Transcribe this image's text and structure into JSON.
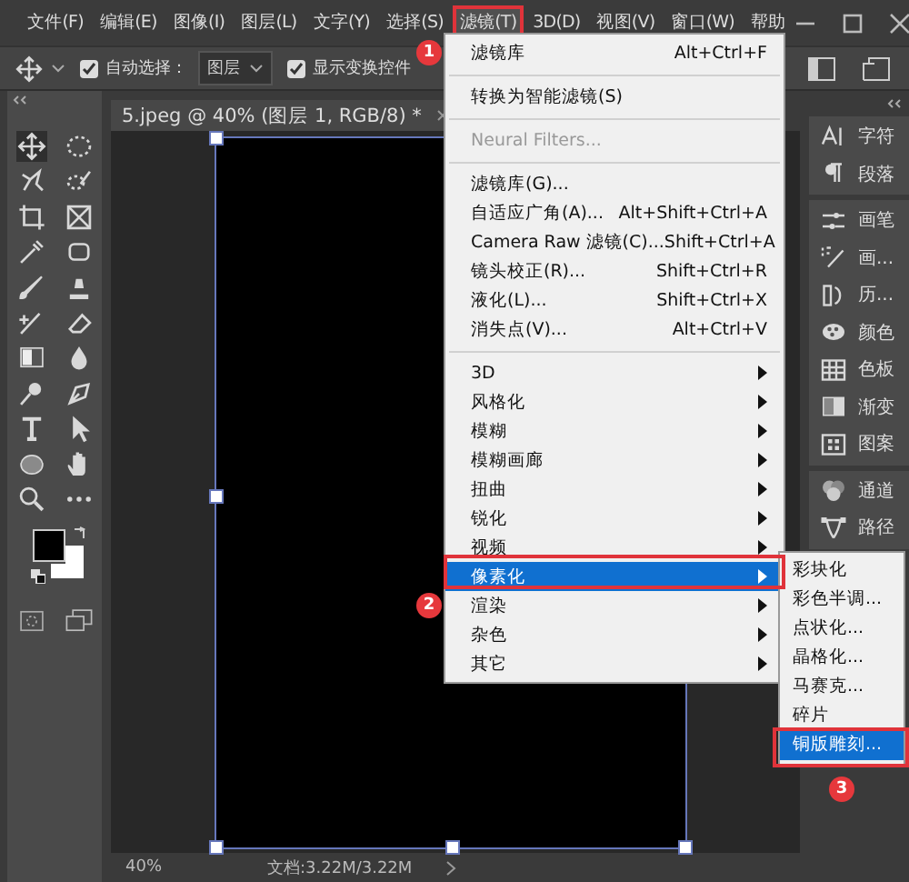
{
  "menubar": {
    "items": [
      {
        "label": "文件(F)",
        "selected": false
      },
      {
        "label": "编辑(E)",
        "selected": false
      },
      {
        "label": "图像(I)",
        "selected": false
      },
      {
        "label": "图层(L)",
        "selected": false
      },
      {
        "label": "文字(Y)",
        "selected": false
      },
      {
        "label": "选择(S)",
        "selected": false
      },
      {
        "label": "滤镜(T)",
        "selected": true
      },
      {
        "label": "3D(D)",
        "selected": false
      },
      {
        "label": "视图(V)",
        "selected": false
      },
      {
        "label": "窗口(W)",
        "selected": false
      },
      {
        "label": "帮助",
        "selected": false
      }
    ]
  },
  "options_bar": {
    "auto_select": {
      "label": "自动选择：",
      "checked": true
    },
    "target_dropdown": "图层",
    "show_transform": {
      "label": "显示变换控件",
      "checked": true
    }
  },
  "document_tab": {
    "title": "5.jpeg @ 40% (图层 1, RGB/8) *"
  },
  "panel_groups": [
    {
      "panels": [
        {
          "label": "字符"
        },
        {
          "label": "段落"
        }
      ]
    },
    {
      "panels": [
        {
          "label": "画笔"
        },
        {
          "label": "画..."
        },
        {
          "label": "历..."
        },
        {
          "label": "颜色"
        },
        {
          "label": "色板"
        },
        {
          "label": "渐变"
        },
        {
          "label": "图案"
        }
      ]
    },
    {
      "panels": [
        {
          "label": "通道"
        },
        {
          "label": "路径"
        }
      ]
    }
  ],
  "filter_menu": {
    "items": [
      {
        "kind": "item",
        "label": "滤镜库",
        "shortcut": "Alt+Ctrl+F",
        "disabled": false,
        "submenu": false,
        "selected": false
      },
      {
        "kind": "separator"
      },
      {
        "kind": "item",
        "label": "转换为智能滤镜(S)",
        "disabled": false,
        "submenu": false,
        "selected": false
      },
      {
        "kind": "separator"
      },
      {
        "kind": "item",
        "label": "Neural Filters...",
        "disabled": true,
        "submenu": false,
        "selected": false
      },
      {
        "kind": "separator"
      },
      {
        "kind": "item",
        "label": "滤镜库(G)...",
        "disabled": false,
        "submenu": false,
        "selected": false
      },
      {
        "kind": "item",
        "label": "自适应广角(A)...",
        "shortcut": "Alt+Shift+Ctrl+A",
        "disabled": false,
        "submenu": false,
        "selected": false
      },
      {
        "kind": "item",
        "label": "Camera Raw 滤镜(C)...",
        "shortcut": "Shift+Ctrl+A",
        "disabled": false,
        "submenu": false,
        "selected": false
      },
      {
        "kind": "item",
        "label": "镜头校正(R)...",
        "shortcut": "Shift+Ctrl+R",
        "disabled": false,
        "submenu": false,
        "selected": false
      },
      {
        "kind": "item",
        "label": "液化(L)...",
        "shortcut": "Shift+Ctrl+X",
        "disabled": false,
        "submenu": false,
        "selected": false
      },
      {
        "kind": "item",
        "label": "消失点(V)...",
        "shortcut": "Alt+Ctrl+V",
        "disabled": false,
        "submenu": false,
        "selected": false
      },
      {
        "kind": "separator"
      },
      {
        "kind": "item",
        "label": "3D",
        "disabled": false,
        "submenu": true,
        "selected": false
      },
      {
        "kind": "item",
        "label": "风格化",
        "disabled": false,
        "submenu": true,
        "selected": false
      },
      {
        "kind": "item",
        "label": "模糊",
        "disabled": false,
        "submenu": true,
        "selected": false
      },
      {
        "kind": "item",
        "label": "模糊画廊",
        "disabled": false,
        "submenu": true,
        "selected": false
      },
      {
        "kind": "item",
        "label": "扭曲",
        "disabled": false,
        "submenu": true,
        "selected": false
      },
      {
        "kind": "item",
        "label": "锐化",
        "disabled": false,
        "submenu": true,
        "selected": false
      },
      {
        "kind": "item",
        "label": "视频",
        "disabled": false,
        "submenu": true,
        "selected": false
      },
      {
        "kind": "item",
        "label": "像素化",
        "disabled": false,
        "submenu": true,
        "selected": true
      },
      {
        "kind": "item",
        "label": "渲染",
        "disabled": false,
        "submenu": true,
        "selected": false
      },
      {
        "kind": "item",
        "label": "杂色",
        "disabled": false,
        "submenu": true,
        "selected": false
      },
      {
        "kind": "item",
        "label": "其它",
        "disabled": false,
        "submenu": true,
        "selected": false
      }
    ]
  },
  "pixelate_submenu": {
    "items": [
      {
        "label": "彩块化",
        "selected": false
      },
      {
        "label": "彩色半调...",
        "selected": false
      },
      {
        "label": "点状化...",
        "selected": false
      },
      {
        "label": "晶格化...",
        "selected": false
      },
      {
        "label": "马赛克...",
        "selected": false
      },
      {
        "label": "碎片",
        "selected": false
      },
      {
        "label": "铜版雕刻...",
        "selected": true
      }
    ]
  },
  "annotations": {
    "steps": [
      "1",
      "2",
      "3"
    ]
  },
  "status_bar": {
    "zoom": "40%",
    "doc_info": "文档:3.22M/3.22M"
  }
}
